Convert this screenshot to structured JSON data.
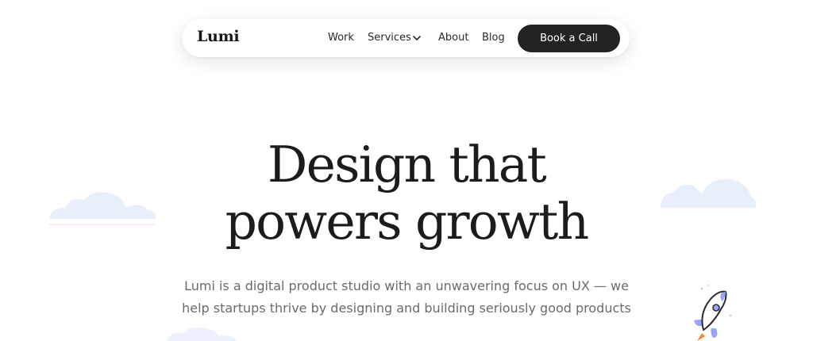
{
  "brand": {
    "logo_text": "Lumi"
  },
  "nav": {
    "items": [
      {
        "label": "Work"
      },
      {
        "label": "Services"
      },
      {
        "label": "About"
      },
      {
        "label": "Blog"
      }
    ],
    "cta_label": "Book a Call"
  },
  "hero": {
    "title_lines": [
      "Design that",
      "powers growth"
    ],
    "subtitle_lines": [
      "Lumi is a digital product studio with an unwavering focus on UX — we",
      "help startups thrive by designing and building seriously good products"
    ]
  },
  "icons": {
    "services_dropdown": "chevron-down-icon",
    "decor_left": "cloud-icon",
    "decor_right": "cloud-icon",
    "decor_bottom": "cloud-icon",
    "decor_rocket": "rocket-icon"
  },
  "colors": {
    "cta_background": "#232323",
    "cta_text": "#ffffff",
    "heading_text": "#1c1c1c",
    "subtitle_text": "#6b6b6b",
    "cloud": "#e9eefb",
    "rocket_body": "#9aa6f5",
    "rocket_flame": "#f08a3a"
  }
}
